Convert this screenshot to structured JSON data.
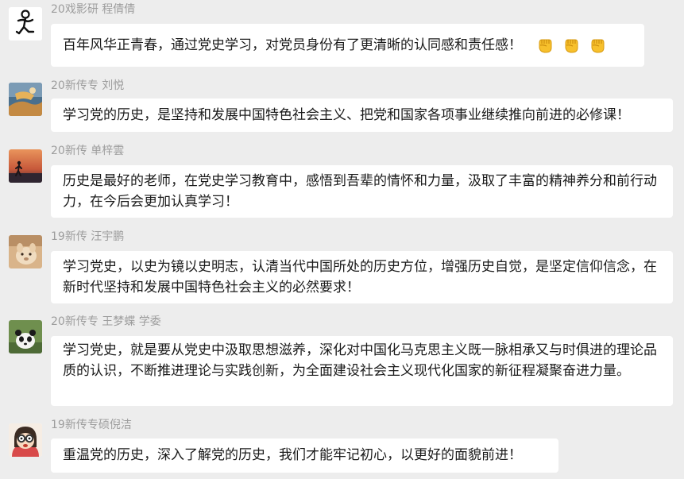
{
  "chat": {
    "messages": [
      {
        "sender": "20戏影研 程倩倩",
        "text": "百年风华正青春，通过党史学习，对党员身份有了更清晰的认同感和责任感！",
        "emojis": [
          "fist-emoji",
          "fist-emoji",
          "fist-emoji"
        ],
        "avatar": "stick-figure-avatar"
      },
      {
        "sender": "20新传专 刘悦",
        "text": "学习党的历史，是坚持和发展中国特色社会主义、把党和国家各项事业继续推向前进的必修课！",
        "avatar": "photo-avatar"
      },
      {
        "sender": "20新传 单梓雲",
        "text": "历史是最好的老师，在党史学习教育中，感悟到吾辈的情怀和力量，汲取了丰富的精神养分和前行动力，在今后会更加认真学习！",
        "avatar": "sunset-silhouette-avatar"
      },
      {
        "sender": "19新传 汪宇鹏",
        "text": "学习党史，以史为镜以史明志，认清当代中国所处的历史方位，增强历史自觉，是坚定信仰信念，在新时代坚持和发展中国特色社会主义的必然要求！",
        "avatar": "alpaca-avatar"
      },
      {
        "sender": "20新传专 王梦蝶 学委",
        "text": "学习党史，就是要从党史中汲取思想滋养，深化对中国化马克思主义既一脉相承又与时俱进的理论品质的认识，不断推进理论与实践创新，为全面建设社会主义现代化国家的新征程凝聚奋进力量。",
        "avatar": "panda-avatar"
      },
      {
        "sender": "19新传专硕倪洁",
        "text": "重温党的历史，深入了解党的历史，我们才能牢记初心，以更好的面貌前进！",
        "avatar": "cartoon-girl-avatar"
      }
    ]
  }
}
